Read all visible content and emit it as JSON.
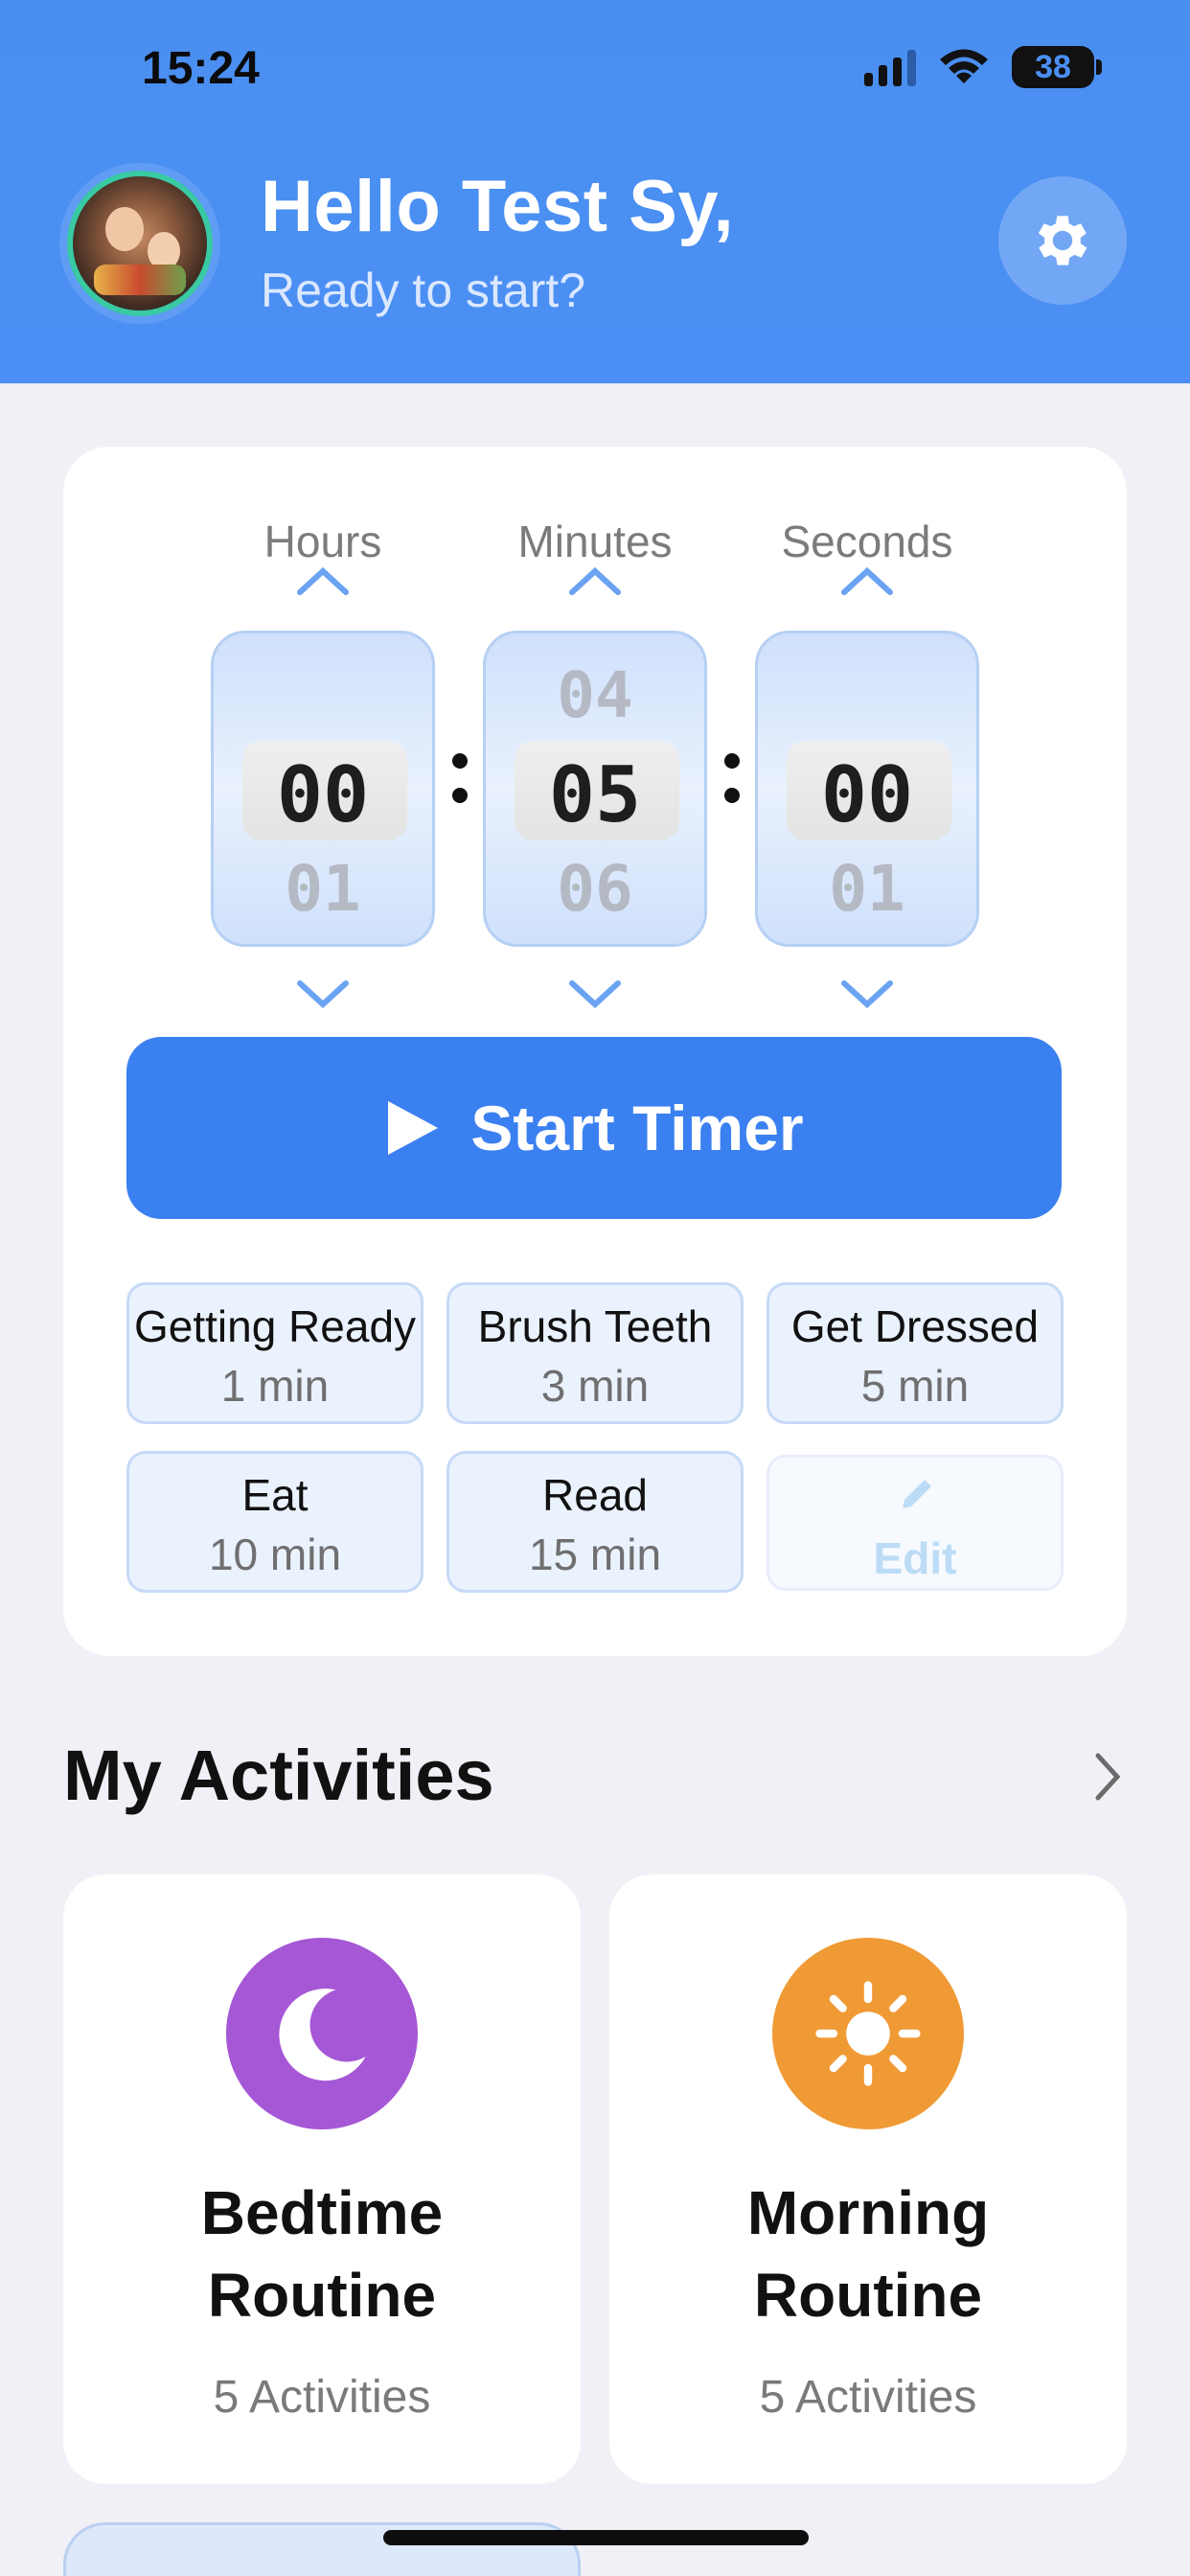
{
  "status_bar": {
    "time": "15:24",
    "battery": "38"
  },
  "header": {
    "greeting": "Hello Test Sy,",
    "subtitle": "Ready to start?"
  },
  "timer": {
    "hours": {
      "label": "Hours",
      "prev": "",
      "value": "00",
      "next": "01"
    },
    "minutes": {
      "label": "Minutes",
      "prev": "04",
      "value": "05",
      "next": "06"
    },
    "seconds": {
      "label": "Seconds",
      "prev": "",
      "value": "00",
      "next": "01"
    },
    "start_label": "Start Timer"
  },
  "presets": [
    {
      "name": "Getting Ready",
      "duration": "1 min"
    },
    {
      "name": "Brush Teeth",
      "duration": "3 min"
    },
    {
      "name": "Get Dressed",
      "duration": "5 min"
    },
    {
      "name": "Eat",
      "duration": "10 min"
    },
    {
      "name": "Read",
      "duration": "15 min"
    }
  ],
  "edit_label": "Edit",
  "activities": {
    "title": "My Activities",
    "items": [
      {
        "title_line1": "Bedtime",
        "title_line2": "Routine",
        "subtitle": "5 Activities",
        "icon": "moon-icon",
        "color": "#a557d6"
      },
      {
        "title_line1": "Morning",
        "title_line2": "Routine",
        "subtitle": "5 Activities",
        "icon": "sun-icon",
        "color": "#f09a35"
      }
    ]
  },
  "colors": {
    "header": "#4b8ff4",
    "accent": "#3b80f0",
    "bedtime": "#a557d6",
    "morning": "#f09a35"
  }
}
